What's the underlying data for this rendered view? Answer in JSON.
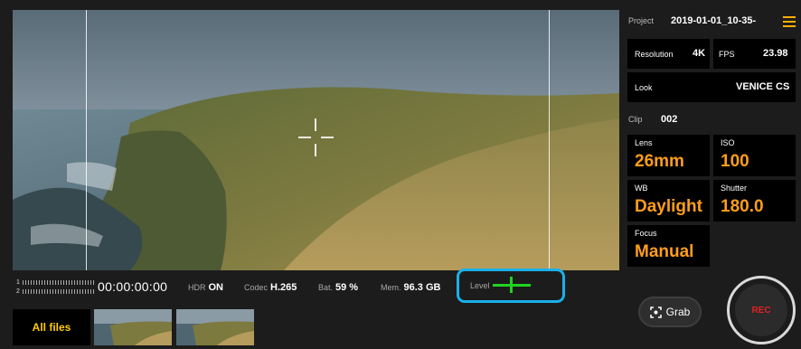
{
  "status": {
    "audio_ch1": "1",
    "audio_ch2": "2",
    "timecode": "00:00:00:00",
    "hdr_label": "HDR",
    "hdr_value": "ON",
    "codec_label": "Codec",
    "codec_value": "H.265",
    "battery_label": "Bat.",
    "battery_value": "59 %",
    "memory_label": "Mem.",
    "memory_value": "96.3 GB",
    "level_label": "Level"
  },
  "bottom": {
    "all_files_label": "All files"
  },
  "panel": {
    "project_label": "Project",
    "project_value": "2019-01-01_10-35-",
    "resolution_label": "Resolution",
    "resolution_value": "4K",
    "fps_label": "FPS",
    "fps_value": "23.98",
    "look_label": "Look",
    "look_value": "VENICE CS",
    "clip_label": "Clip",
    "clip_value": "002",
    "lens_label": "Lens",
    "lens_value": "26mm",
    "iso_label": "ISO",
    "iso_value": "100",
    "wb_label": "WB",
    "wb_value": "Daylight",
    "shutter_label": "Shutter",
    "shutter_value": "180.0",
    "focus_label": "Focus",
    "focus_value": "Manual"
  },
  "controls": {
    "grab_label": "Grab",
    "rec_label": "REC"
  },
  "icons": {
    "menu": "menu-icon",
    "grab": "grab-icon"
  },
  "colors": {
    "accent_orange": "#ff9e1a",
    "highlight_blue": "#1ab0ea",
    "level_green": "#1fd31f",
    "rec_red": "#e02020"
  }
}
